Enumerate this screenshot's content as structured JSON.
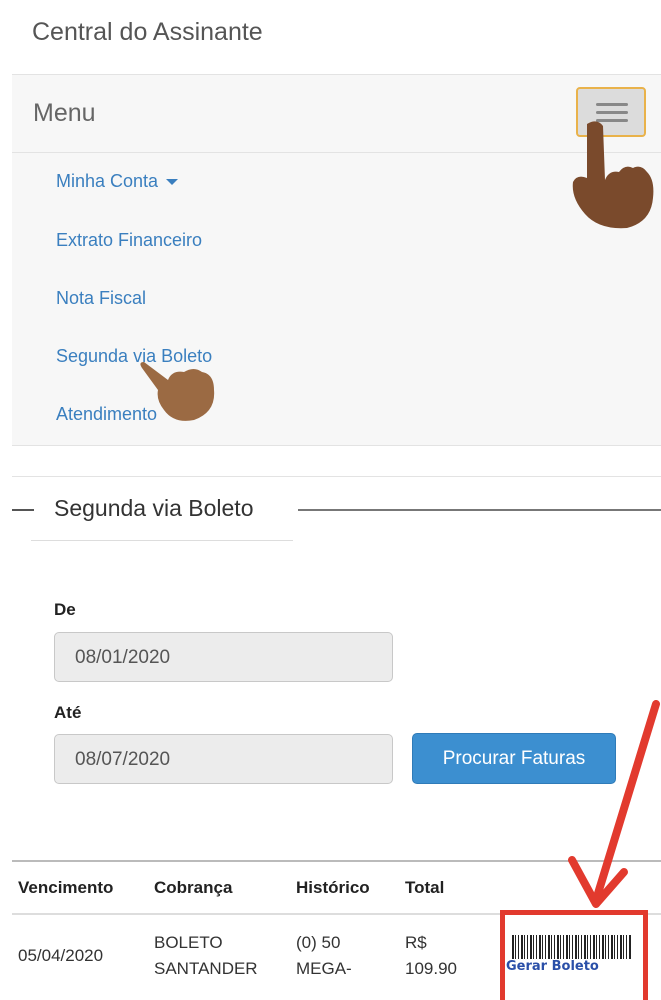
{
  "header": {
    "app_title": "Central do Assinante"
  },
  "navbar": {
    "menu_label": "Menu",
    "items": [
      {
        "label": "Minha Conta",
        "has_dropdown": true
      },
      {
        "label": "Extrato Financeiro"
      },
      {
        "label": "Nota Fiscal"
      },
      {
        "label": "Segunda via Boleto"
      },
      {
        "label": "Atendimento"
      }
    ]
  },
  "section": {
    "title": "Segunda via Boleto",
    "from_label": "De",
    "from_value": "08/01/2020",
    "to_label": "Até",
    "to_value": "08/07/2020",
    "search_button": "Procurar Faturas"
  },
  "table": {
    "headers": [
      "Vencimento",
      "Cobrança",
      "Histórico",
      "Total"
    ],
    "rows": [
      {
        "vencimento": "05/04/2020",
        "cobranca_line1": "BOLETO",
        "cobranca_line2": "SANTANDER",
        "historico_line1": "(0) 50",
        "historico_line2": "MEGA-",
        "total_line1": "R$",
        "total_line2": "109.90",
        "action_label": "Gerar Boleto"
      }
    ]
  },
  "colors": {
    "link": "#3a7fbf",
    "button": "#3c8fd0",
    "highlight": "#e23a2e",
    "hand": "#8a5a3a"
  },
  "icons": {
    "hamburger": "hamburger-menu-icon",
    "pointer_hand": "pointing-hand-icon",
    "arrow": "red-arrow-annotation",
    "barcode": "barcode-icon"
  }
}
